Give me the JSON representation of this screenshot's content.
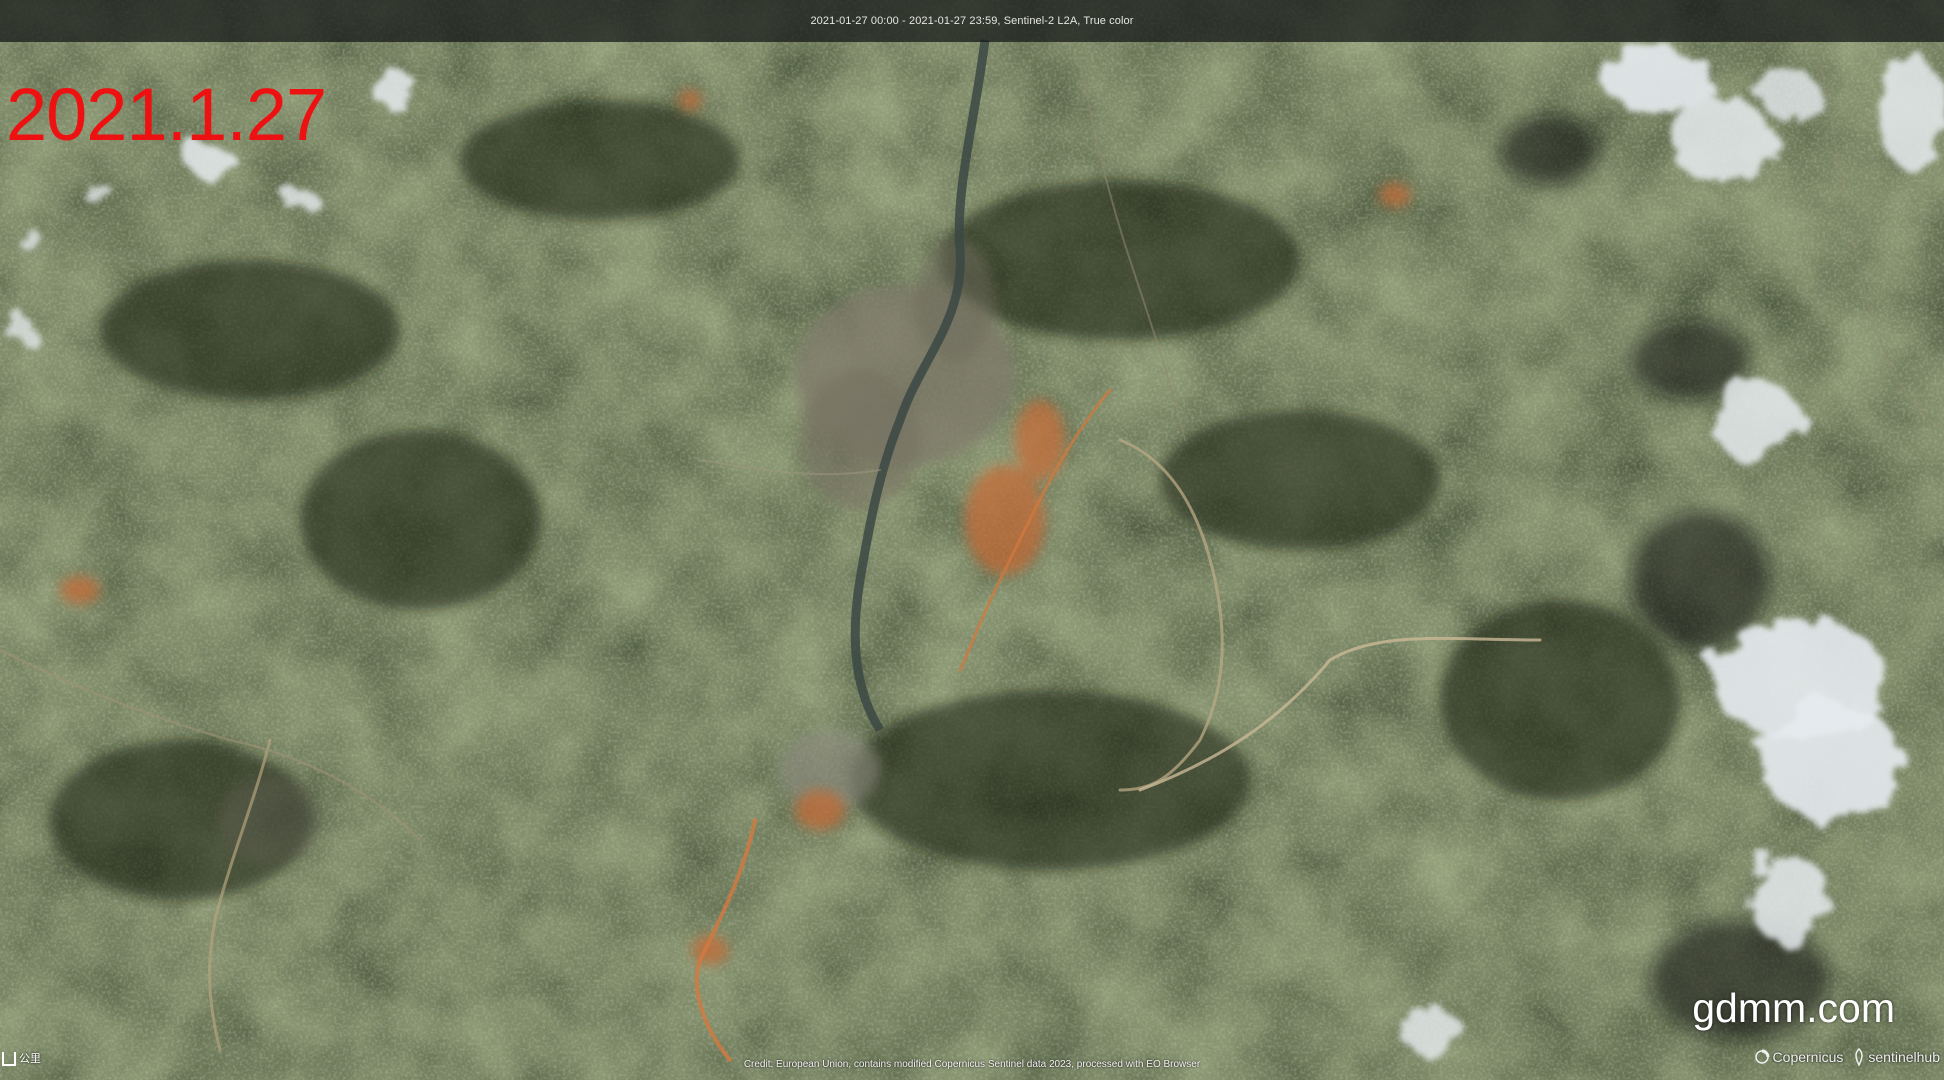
{
  "header": {
    "info": "2021-01-27 00:00 - 2021-01-27 23:59, Sentinel-2 L2A, True color"
  },
  "overlay": {
    "date": "2021.1.27",
    "date_color": "#ee1111",
    "watermark": "gdmm.com"
  },
  "footer": {
    "credit": "Credit: European Union, contains modified Copernicus Sentinel data 2023, processed with EO Browser",
    "scale_label": "公里",
    "logos": [
      {
        "name": "copernicus-logo",
        "text": "Copernicus"
      },
      {
        "name": "sentinelhub-logo",
        "text": "sentinelhub"
      }
    ]
  },
  "map": {
    "imagery": "satellite-true-color",
    "colors": {
      "forest": "#2a3320",
      "forest_dark": "#1a2114",
      "urban": "#8a8778",
      "bare_soil": "#c9733f",
      "river": "#3a4a46",
      "cloud": "#e9eef2",
      "cloud_shadow": "#101410"
    }
  }
}
